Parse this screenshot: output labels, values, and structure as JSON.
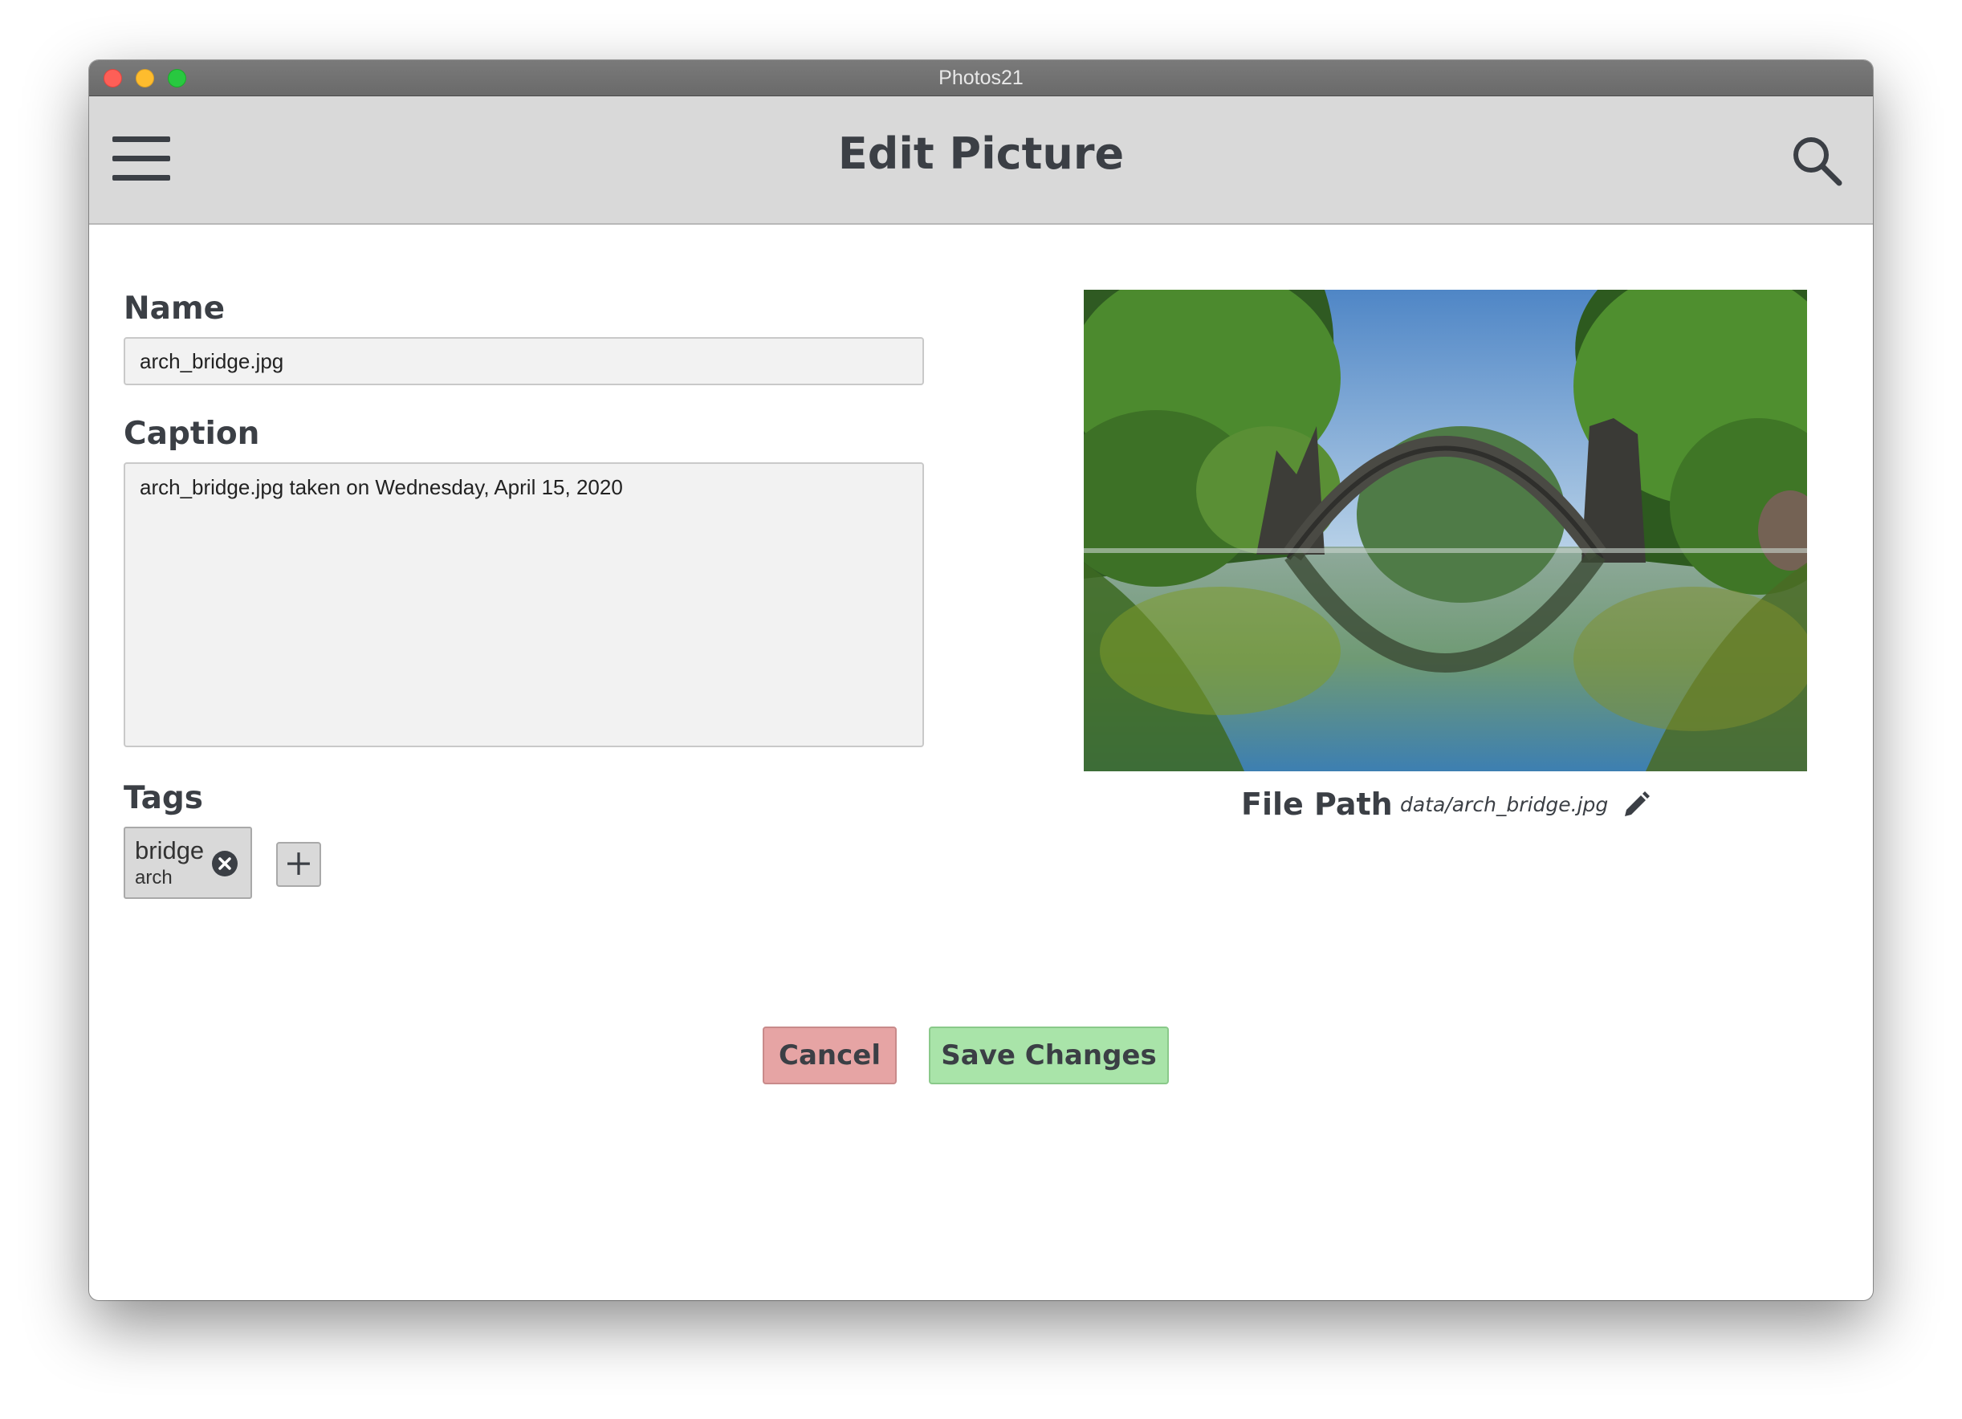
{
  "window": {
    "title": "Photos21"
  },
  "toolbar": {
    "title": "Edit Picture",
    "menu_icon": "hamburger-menu-icon",
    "search_icon": "search-icon"
  },
  "form": {
    "name_label": "Name",
    "name_value": "arch_bridge.jpg",
    "caption_label": "Caption",
    "caption_value": "arch_bridge.jpg taken on Wednesday, April 15, 2020",
    "tags_label": "Tags",
    "tags": [
      {
        "primary": "bridge",
        "secondary": "arch"
      }
    ],
    "add_tag_icon": "plus-icon",
    "remove_tag_icon": "close-circle-icon"
  },
  "photo": {
    "file_path_label": "File Path",
    "file_path_value": "data/arch_bridge.jpg",
    "edit_icon": "pencil-icon"
  },
  "actions": {
    "cancel_label": "Cancel",
    "save_label": "Save Changes"
  },
  "colors": {
    "toolbar_bg": "#d9d9d9",
    "text_dark": "#3b3f45",
    "cancel_bg": "#e6a4a4",
    "save_bg": "#a9e4a9",
    "field_bg": "#f2f2f2"
  }
}
